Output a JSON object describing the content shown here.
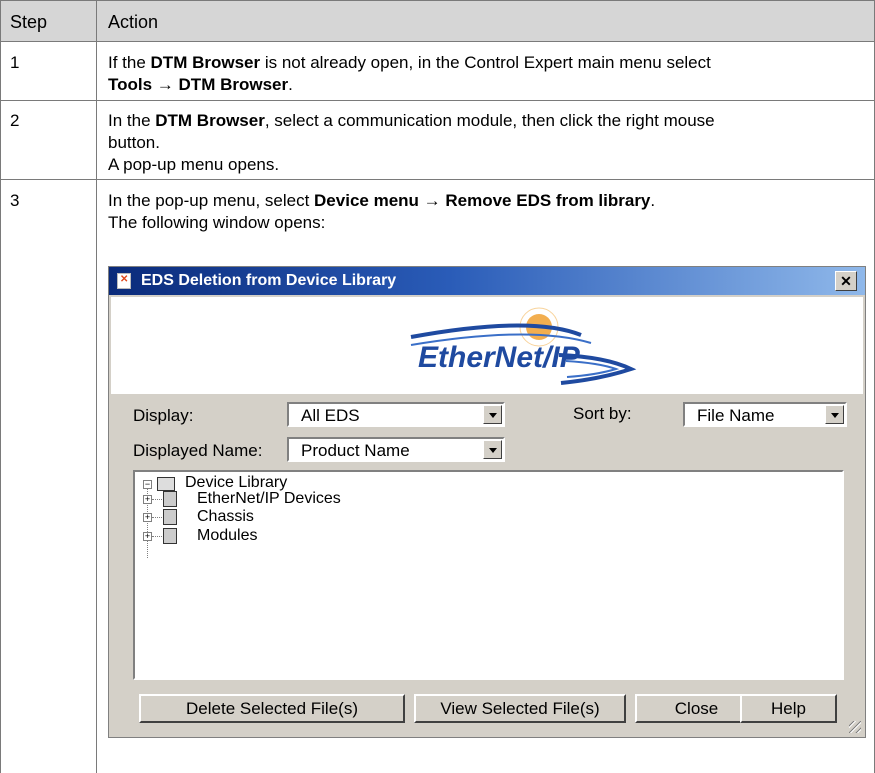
{
  "table": {
    "header": {
      "step": "Step",
      "action": "Action"
    },
    "rows": [
      {
        "step": "1",
        "line1_a": "If the ",
        "line1_b": "DTM Browser",
        "line1_c": " is not already open, in the Control Expert main menu select",
        "line2_a": "Tools",
        "line2_arrow": " → ",
        "line2_b": "DTM Browser",
        "line2_c": "."
      },
      {
        "step": "2",
        "line1_a": "In the ",
        "line1_b": "DTM Browser",
        "line1_c": ", select a communication module, then click the right mouse",
        "line2": "button.",
        "line3": "A pop-up menu opens."
      },
      {
        "step": "3",
        "line1_a": "In the pop-up menu, select ",
        "line1_b": "Device menu",
        "line1_arrow": " → ",
        "line1_c": "Remove EDS from library",
        "line1_d": ".",
        "line2": "The following window opens:"
      }
    ]
  },
  "dialog": {
    "title": "EDS Deletion from Device Library",
    "close_glyph": "✕",
    "logo_text": "EtherNet/IP",
    "display_label": "Display:",
    "display_value": "All EDS",
    "sort_label": "Sort by:",
    "sort_value": "File Name",
    "displayed_name_label": "Displayed Name:",
    "displayed_name_value": "Product Name",
    "tree": {
      "root": "Device Library",
      "children": [
        "EtherNet/IP Devices",
        "Chassis",
        "Modules"
      ]
    },
    "buttons": {
      "delete": "Delete Selected File(s)",
      "view": "View Selected File(s)",
      "close": "Close",
      "help": "Help"
    }
  },
  "colors": {
    "title_gradient_start": "#0a2a7a",
    "title_gradient_end": "#8fb8ea",
    "logo_blue": "#1f4aa0",
    "logo_orange": "#f0a030",
    "dialog_face": "#d4d0c8",
    "table_header": "#d6d6d6"
  }
}
